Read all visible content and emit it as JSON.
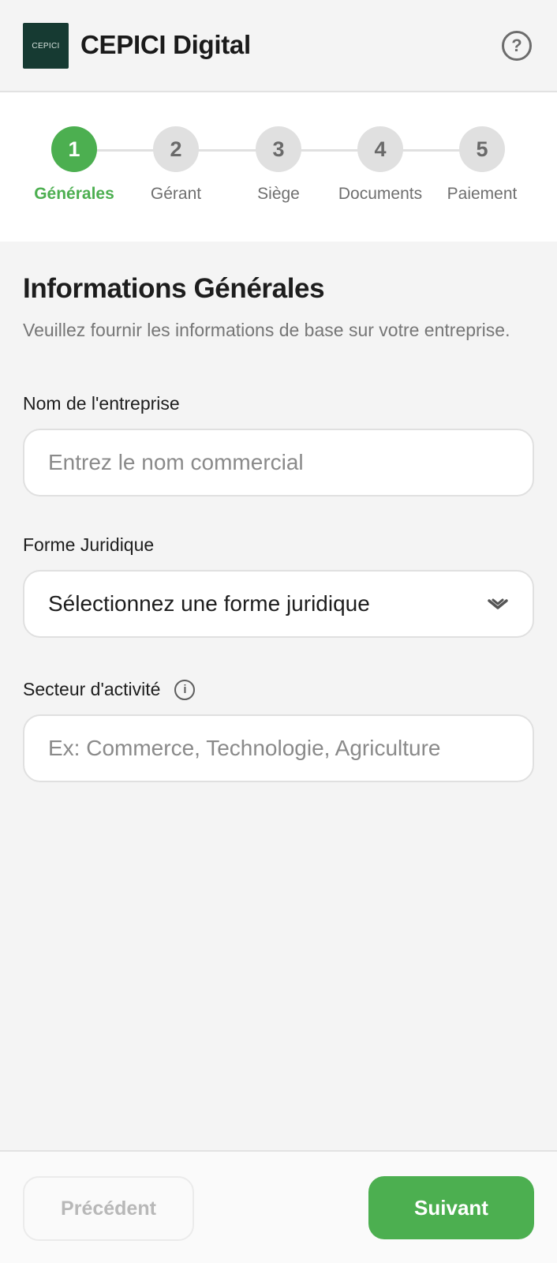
{
  "header": {
    "logo_text": "CEPICI",
    "title": "CEPICI Digital",
    "help_icon": "help-circle-icon",
    "help_glyph": "?"
  },
  "stepper": {
    "active_index": 0,
    "active_color": "#4caf50",
    "steps": [
      {
        "number": "1",
        "label": "Générales"
      },
      {
        "number": "2",
        "label": "Gérant"
      },
      {
        "number": "3",
        "label": "Siège"
      },
      {
        "number": "4",
        "label": "Documents"
      },
      {
        "number": "5",
        "label": "Paiement"
      }
    ]
  },
  "form": {
    "title": "Informations Générales",
    "description": "Veuillez fournir les informations de base sur votre entreprise.",
    "company_name": {
      "label": "Nom de l'entreprise",
      "value": "",
      "placeholder": "Entrez le nom commercial"
    },
    "legal_form": {
      "label": "Forme Juridique",
      "selected": "Sélectionnez une forme juridique",
      "icon": "chevron-down-icon"
    },
    "sector": {
      "label": "Secteur d'activité",
      "info_icon": "info-icon",
      "info_glyph": "i",
      "value": "",
      "placeholder": "Ex: Commerce, Technologie, Agriculture"
    }
  },
  "footer": {
    "prev_label": "Précédent",
    "next_label": "Suivant",
    "next_color": "#4caf50"
  }
}
